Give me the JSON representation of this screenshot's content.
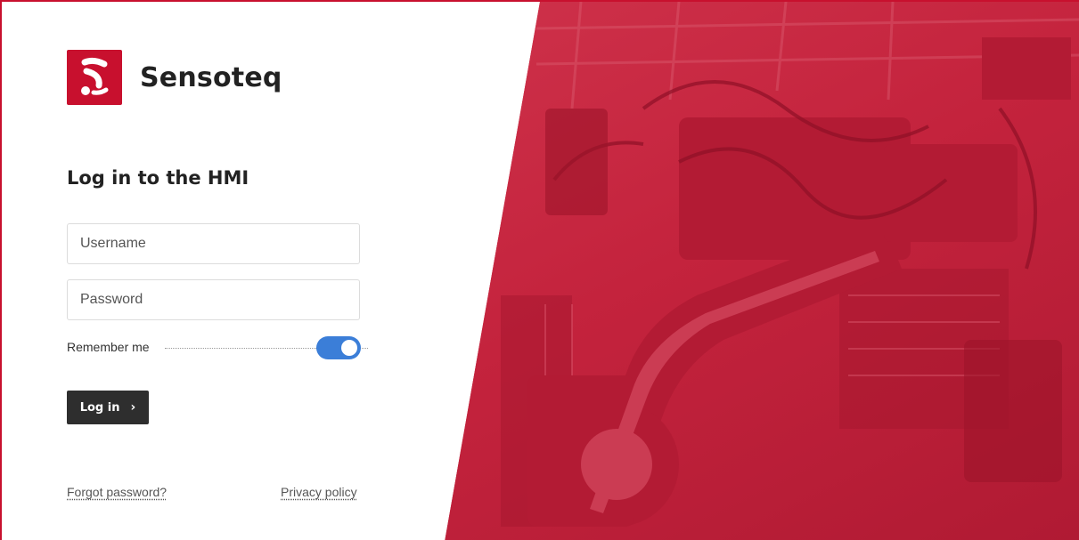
{
  "brand": {
    "name": "Sensoteq",
    "logo_icon": "sensoteq-s-logo",
    "color": "#c8102e"
  },
  "login": {
    "title": "Log in to the HMI",
    "username_placeholder": "Username",
    "password_placeholder": "Password",
    "remember_label": "Remember me",
    "remember_checked": true,
    "submit_label": "Log in",
    "submit_icon": "chevron-right-icon"
  },
  "links": {
    "forgot_password": "Forgot password?",
    "privacy_policy": "Privacy policy"
  },
  "hero": {
    "overlay_color": "#c4233d",
    "subject": "industrial-robot-arm-photo"
  },
  "colors": {
    "toggle_on": "#3b7ed8",
    "button_bg": "#2e2e2e"
  }
}
